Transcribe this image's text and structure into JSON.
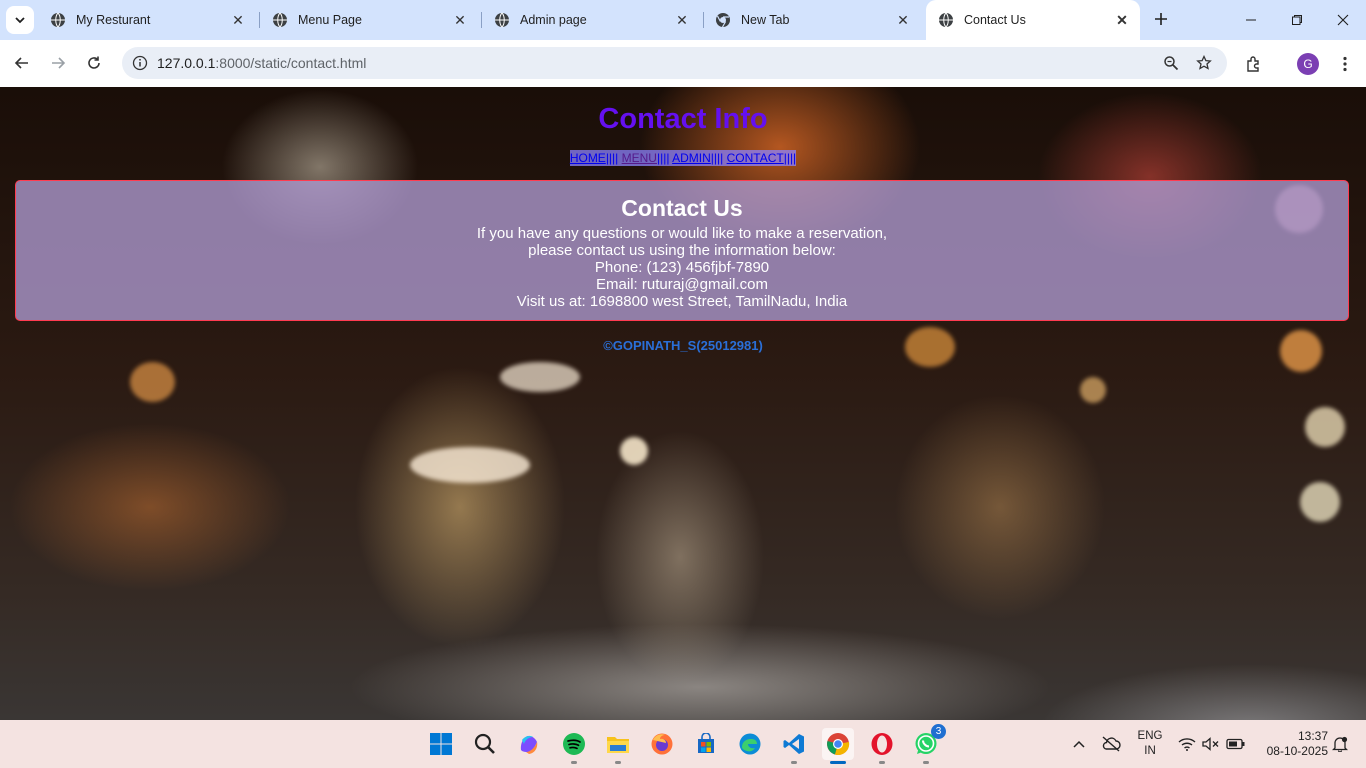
{
  "browser": {
    "tabs": [
      {
        "title": "My Resturant",
        "icon": "globe-icon",
        "active": false
      },
      {
        "title": "Menu Page",
        "icon": "globe-icon",
        "active": false
      },
      {
        "title": "Admin page",
        "icon": "globe-icon",
        "active": false
      },
      {
        "title": "New Tab",
        "icon": "chrome-icon",
        "active": false
      },
      {
        "title": "Contact Us",
        "icon": "globe-icon",
        "active": true
      }
    ],
    "url_host": "127.0.0.1",
    "url_rest": ":8000/static/contact.html",
    "profile_initial": "G"
  },
  "page": {
    "title": "Contact Info",
    "nav": {
      "home": "HOME",
      "menu": "MENU",
      "admin": "ADMIN",
      "contact": "CONTACT",
      "separator": "||||"
    },
    "contact": {
      "heading": "Contact Us",
      "line1": "If you have any questions or would like to make a reservation,",
      "line2": "please contact us using the information below:",
      "phone": "Phone: (123) 456fjbf-7890",
      "email": "Email: ruturaj@gmail.com",
      "address": "Visit us at: 1698800 west Street, TamilNadu, India"
    },
    "footer": "©GOPINATH_S(25012981)"
  },
  "taskbar": {
    "apps": [
      "windows-start-icon",
      "search-icon",
      "copilot-icon",
      "spotify-icon",
      "file-explorer-icon",
      "firefox-icon",
      "microsoft-store-icon",
      "edge-icon",
      "vscode-icon",
      "chrome-icon",
      "opera-icon",
      "whatsapp-icon"
    ],
    "whatsapp_badge": "3",
    "lang_top": "ENG",
    "lang_bottom": "IN",
    "time": "13:37",
    "date": "08-10-2025"
  }
}
